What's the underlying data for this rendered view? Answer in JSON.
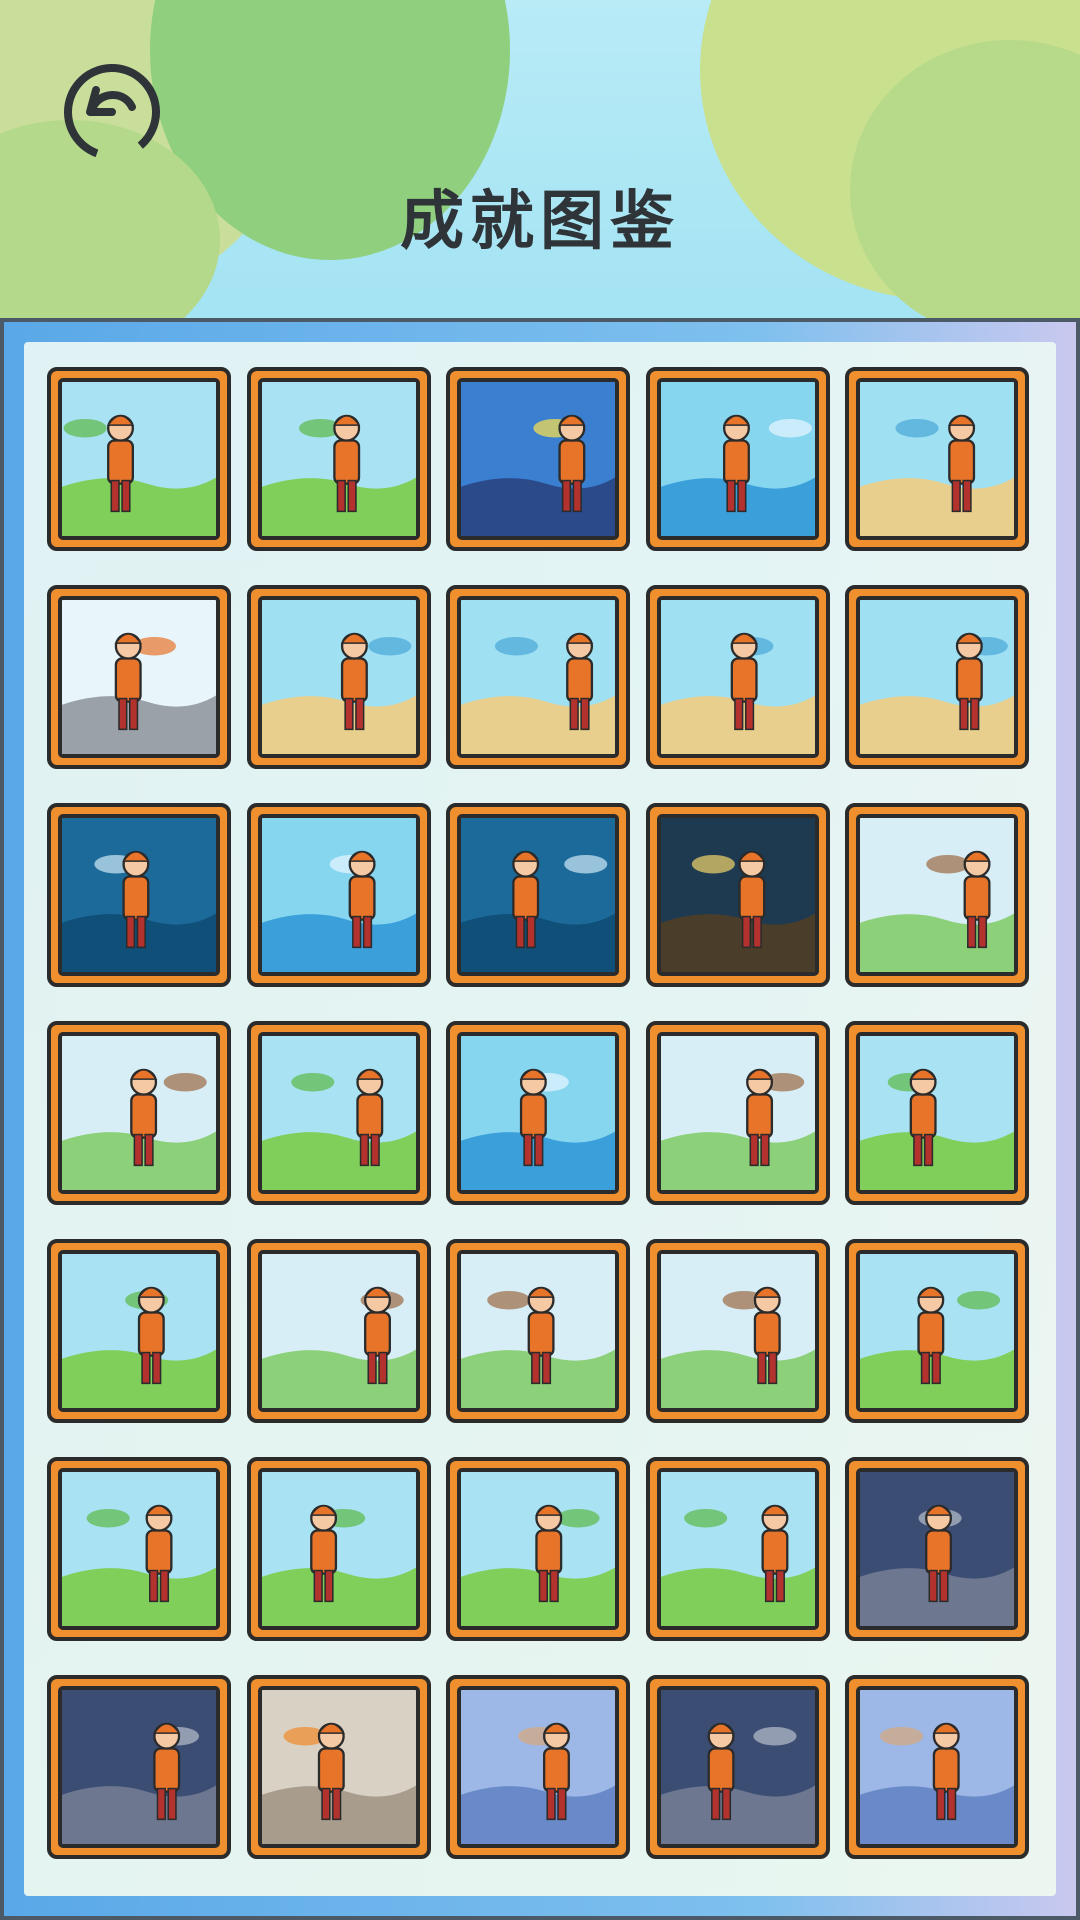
{
  "header": {
    "title": "成就图鉴",
    "back_icon": "undo-arrow-icon"
  },
  "achievements": [
    {
      "scene": "grass"
    },
    {
      "scene": "grass"
    },
    {
      "scene": "storm"
    },
    {
      "scene": "sea"
    },
    {
      "scene": "beach"
    },
    {
      "scene": "cliff"
    },
    {
      "scene": "beach"
    },
    {
      "scene": "beach"
    },
    {
      "scene": "beach"
    },
    {
      "scene": "beach"
    },
    {
      "scene": "deep"
    },
    {
      "scene": "sea"
    },
    {
      "scene": "deep"
    },
    {
      "scene": "night"
    },
    {
      "scene": "forest"
    },
    {
      "scene": "forest"
    },
    {
      "scene": "grass"
    },
    {
      "scene": "sea"
    },
    {
      "scene": "forest"
    },
    {
      "scene": "grass"
    },
    {
      "scene": "grass"
    },
    {
      "scene": "forest"
    },
    {
      "scene": "forest"
    },
    {
      "scene": "forest"
    },
    {
      "scene": "grass"
    },
    {
      "scene": "grass"
    },
    {
      "scene": "grass"
    },
    {
      "scene": "grass"
    },
    {
      "scene": "grass"
    },
    {
      "scene": "cave"
    },
    {
      "scene": "cave"
    },
    {
      "scene": "camp"
    },
    {
      "scene": "vine"
    },
    {
      "scene": "cave"
    },
    {
      "scene": "vine"
    }
  ],
  "colors": {
    "card_frame": "#f08f2d",
    "outline": "#2b2b2b",
    "hero": "#e8742a",
    "panel_blue": "#5aa8e8"
  }
}
